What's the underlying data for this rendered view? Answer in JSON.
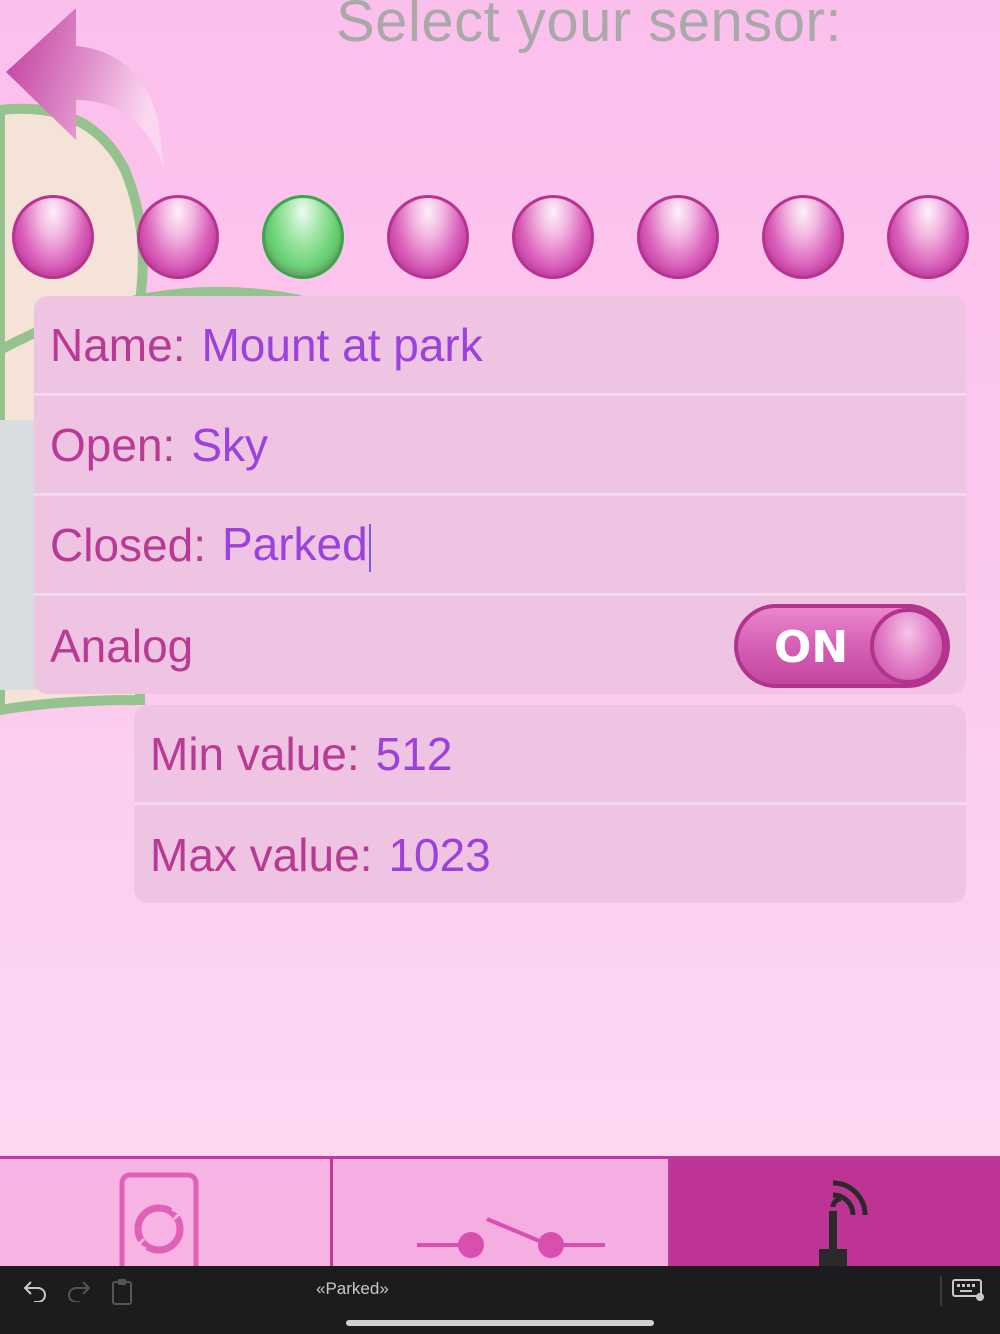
{
  "header": {
    "title": "Select your sensor:"
  },
  "sensors": {
    "count": 8,
    "selected_index": 2
  },
  "form": {
    "name_label": "Name:",
    "name_value": "Mount at park",
    "open_label": "Open:",
    "open_value": "Sky",
    "closed_label": "Closed:",
    "closed_value": "Parked",
    "analog_label": "Analog",
    "analog_toggle_text": "ON",
    "min_label": "Min value:",
    "min_value": "512",
    "max_label": "Max value:",
    "max_value": "1023"
  },
  "keyboard_bar": {
    "suggestion": "«Parked»"
  },
  "colors": {
    "accent": "#c0399b",
    "label": "#b93a95",
    "value": "#9b41dd",
    "selected_sensor": "#5cc767",
    "title": "#a9a9a9"
  },
  "icons": {
    "back": "back-arrow-icon",
    "tab1": "device-sync-icon",
    "tab2": "switch-icon",
    "tab3": "antenna-signal-icon"
  }
}
